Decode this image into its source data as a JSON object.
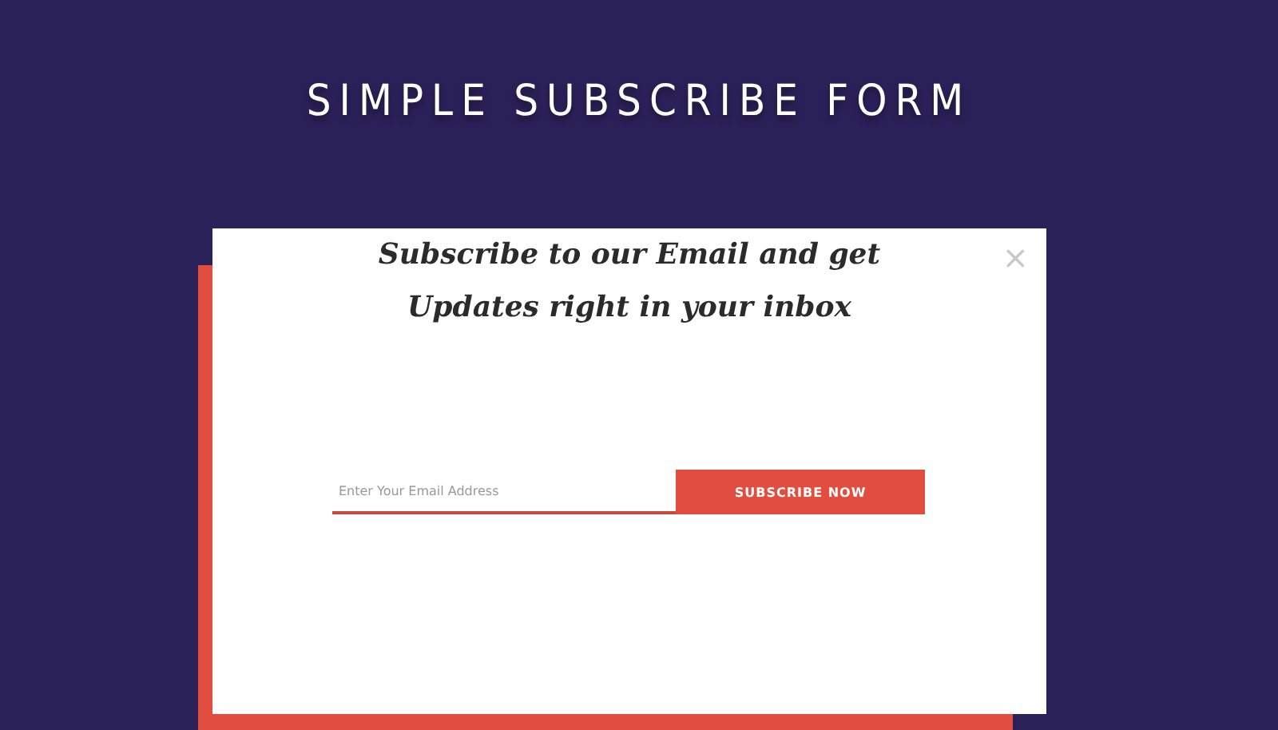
{
  "page": {
    "title": "SIMPLE SUBSCRIBE FORM"
  },
  "dialog": {
    "close": "×",
    "heading": "Subscribe to our Email and get Updates right in your inbox",
    "email": {
      "placeholder": "Enter Your Email Address"
    },
    "button": "SUBSCRIBE NOW"
  }
}
